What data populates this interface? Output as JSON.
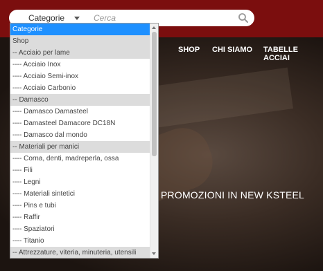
{
  "search": {
    "category_label": "Categorie",
    "placeholder": "Cerca"
  },
  "nav": {
    "items": [
      "SHOP",
      "CHI SIAMO",
      "TABELLE ACCIAI"
    ]
  },
  "hero": {
    "promo_text": "PROMOZIONI IN NEW KSTEEL"
  },
  "dropdown": {
    "options": [
      {
        "label": "Categorie",
        "type": "selected"
      },
      {
        "label": "Shop",
        "type": "group"
      },
      {
        "label": "-- Acciaio per lame",
        "type": "group"
      },
      {
        "label": "---- Acciaio Inox",
        "type": "item"
      },
      {
        "label": "---- Acciaio Semi-inox",
        "type": "item"
      },
      {
        "label": "---- Acciaio Carbonio",
        "type": "item"
      },
      {
        "label": "-- Damasco",
        "type": "group"
      },
      {
        "label": "---- Damasco Damasteel",
        "type": "item"
      },
      {
        "label": "---- Damasteel Damacore DC18N",
        "type": "item"
      },
      {
        "label": "---- Damasco dal mondo",
        "type": "item"
      },
      {
        "label": "-- Materiali per manici",
        "type": "group"
      },
      {
        "label": "---- Corna, denti, madreperla, ossa",
        "type": "item"
      },
      {
        "label": "---- Fili",
        "type": "item"
      },
      {
        "label": "---- Legni",
        "type": "item"
      },
      {
        "label": "---- Materiali sintetici",
        "type": "item"
      },
      {
        "label": "---- Pins e tubi",
        "type": "item"
      },
      {
        "label": "---- Raffir",
        "type": "item"
      },
      {
        "label": "---- Spaziatori",
        "type": "item"
      },
      {
        "label": "---- Titanio",
        "type": "item"
      },
      {
        "label": "-- Attrezzature, viteria, minuteria, utensili",
        "type": "group"
      }
    ]
  },
  "colors": {
    "header_red": "#7b0e0e",
    "selected_blue": "#1e90ff",
    "group_gray": "#dcdcdc"
  }
}
